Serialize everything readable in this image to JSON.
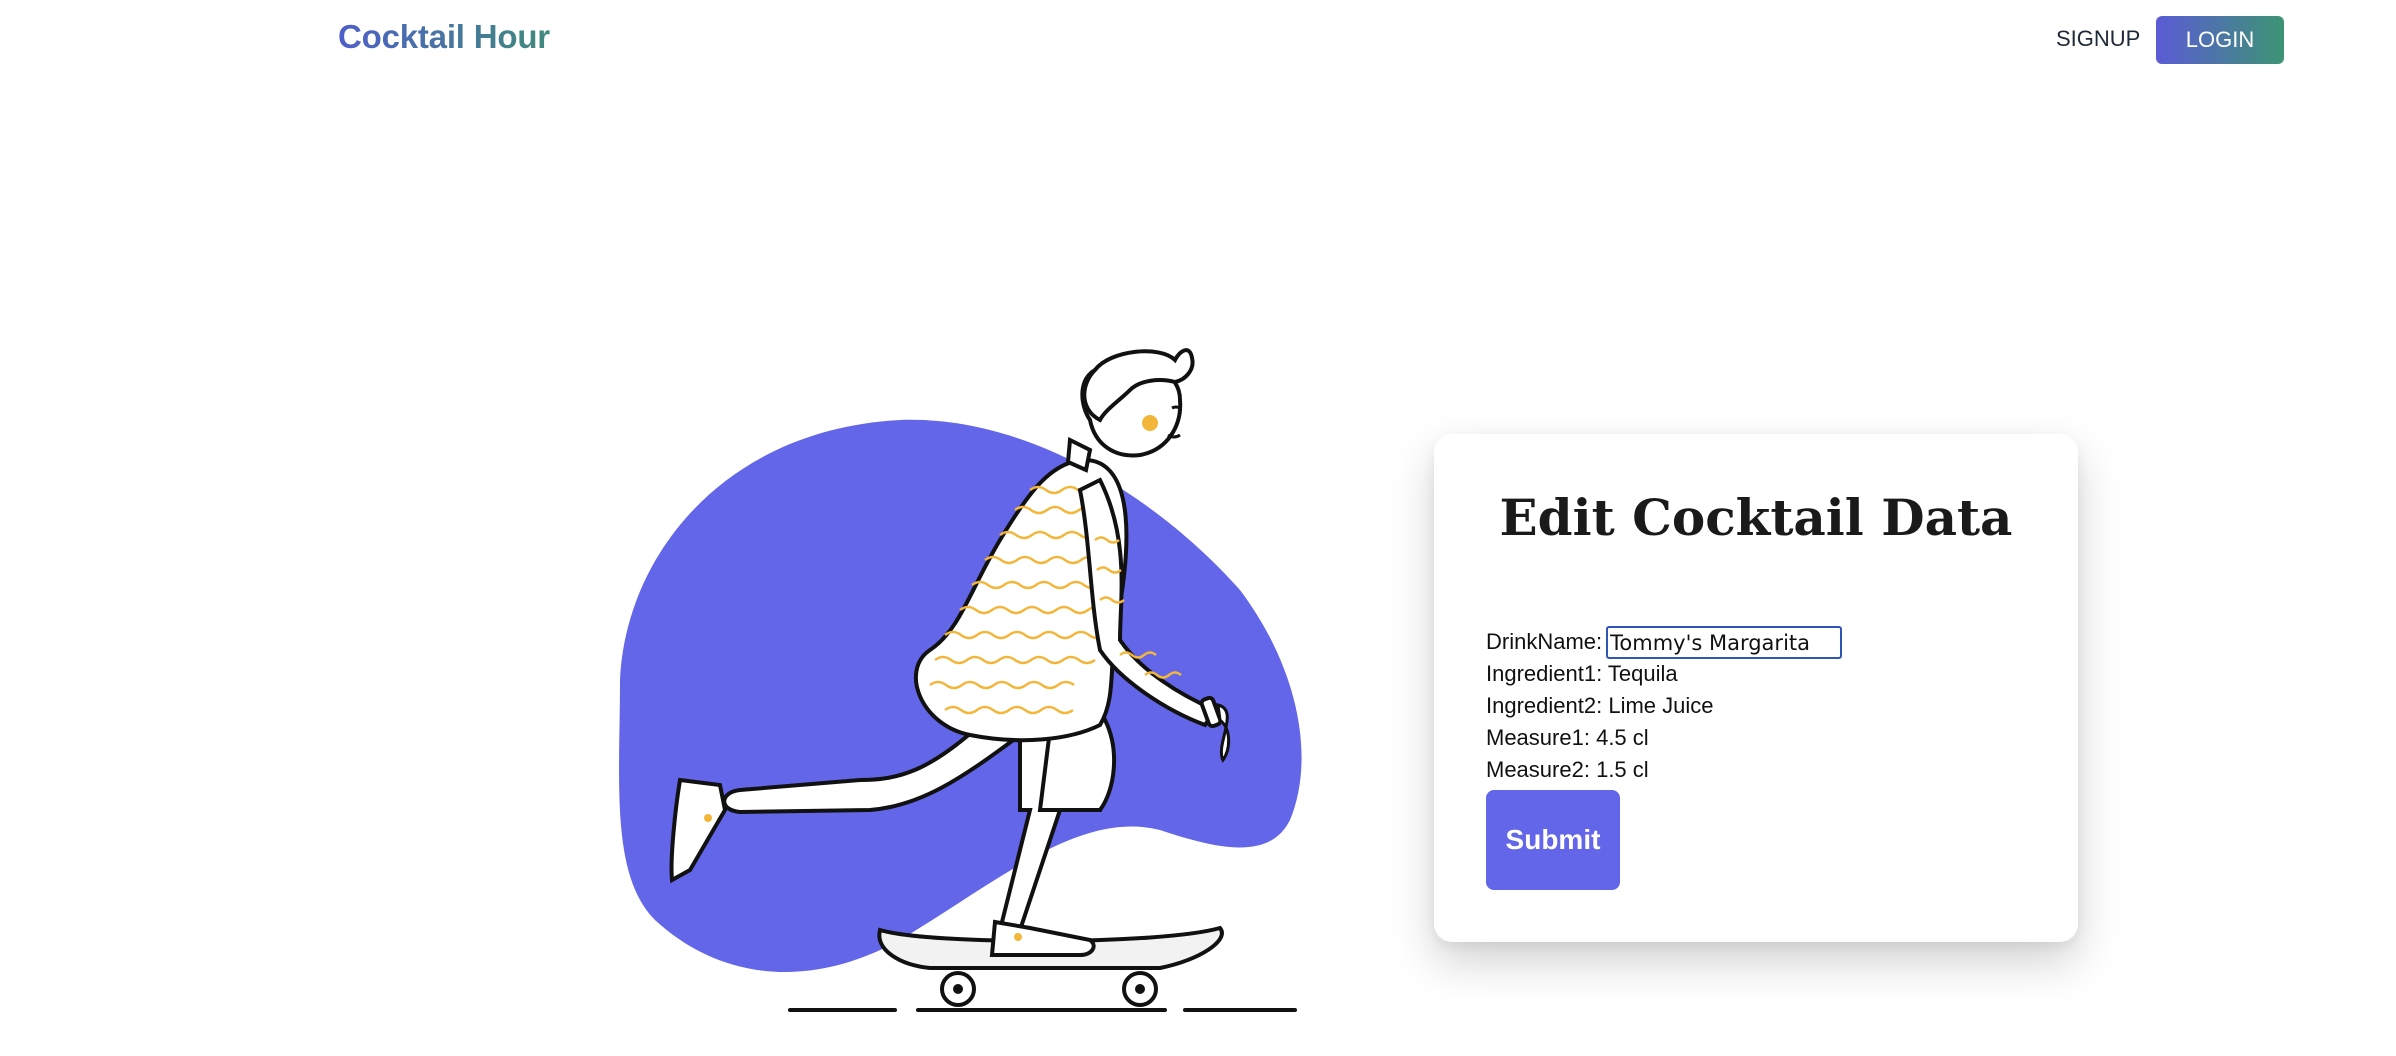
{
  "navbar": {
    "brand": "Cocktail Hour",
    "signup_label": "SIGNUP",
    "login_label": "LOGIN"
  },
  "illustration": {
    "subject": "person riding skateboard",
    "blob_color": "#6366e9",
    "accent_color": "#f2b63a"
  },
  "form": {
    "title": "Edit Cocktail Data",
    "drink_name_label": "DrinkName:",
    "drink_name_value": "Tommy's Margarita",
    "ingredient1_label": "Ingredient1:",
    "ingredient1_value": "Tequila",
    "ingredient2_label": "Ingredient2:",
    "ingredient2_value": "Lime Juice",
    "measure1_label": "Measure1:",
    "measure1_value": "4.5 cl",
    "measure2_label": "Measure2:",
    "measure2_value": "1.5 cl",
    "submit_label": "Submit"
  },
  "colors": {
    "brand_gradient_start": "#4f5fc9",
    "brand_gradient_end": "#3f8a7a",
    "primary": "#6366e9",
    "input_border": "#2f55b8"
  }
}
